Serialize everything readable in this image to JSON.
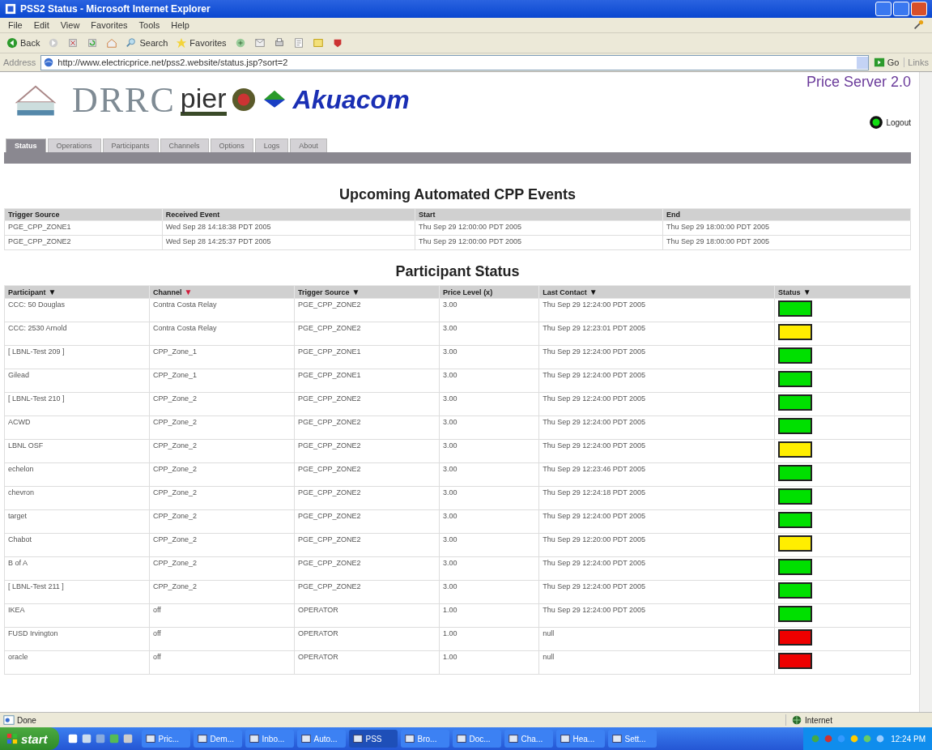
{
  "window": {
    "title": "PSS2 Status - Microsoft Internet Explorer"
  },
  "menu": [
    "File",
    "Edit",
    "View",
    "Favorites",
    "Tools",
    "Help"
  ],
  "toolbar": {
    "back": "Back",
    "search": "Search",
    "favorites": "Favorites"
  },
  "address_bar": {
    "label": "Address",
    "value": "http://www.electricprice.net/pss2.website/status.jsp?sort=2",
    "go": "Go",
    "links": "Links"
  },
  "header": {
    "logos": [
      "DRRC",
      "pier",
      "Akuacom"
    ],
    "product": "Price Server 2.0",
    "logout": "Logout"
  },
  "tabs": [
    {
      "label": "Status",
      "selected": true
    },
    {
      "label": "Operations",
      "selected": false
    },
    {
      "label": "Participants",
      "selected": false
    },
    {
      "label": "Channels",
      "selected": false
    },
    {
      "label": "Options",
      "selected": false
    },
    {
      "label": "Logs",
      "selected": false
    },
    {
      "label": "About",
      "selected": false
    }
  ],
  "events": {
    "title": "Upcoming Automated CPP Events",
    "columns": [
      "Trigger Source",
      "Received Event",
      "Start",
      "End"
    ],
    "rows": [
      [
        "PGE_CPP_ZONE1",
        "Wed Sep 28 14:18:38 PDT 2005",
        "Thu Sep 29 12:00:00 PDT 2005",
        "Thu Sep 29 18:00:00 PDT 2005"
      ],
      [
        "PGE_CPP_ZONE2",
        "Wed Sep 28 14:25:37 PDT 2005",
        "Thu Sep 29 12:00:00 PDT 2005",
        "Thu Sep 29 18:00:00 PDT 2005"
      ]
    ]
  },
  "participants": {
    "title": "Participant Status",
    "columns": [
      {
        "label": "Participant",
        "sort": "▼",
        "sort_active": false
      },
      {
        "label": "Channel",
        "sort": "▼",
        "sort_active": true
      },
      {
        "label": "Trigger Source",
        "sort": "▼",
        "sort_active": false
      },
      {
        "label": "Price Level (x)"
      },
      {
        "label": "Last Contact",
        "sort": "▼",
        "sort_active": false
      },
      {
        "label": "Status",
        "sort": "▼",
        "sort_active": false
      }
    ],
    "rows": [
      {
        "cells": [
          "CCC: 50 Douglas",
          "Contra Costa Relay",
          "PGE_CPP_ZONE2",
          "3.00",
          "Thu Sep 29 12:24:00 PDT 2005"
        ],
        "color": "#00e000"
      },
      {
        "cells": [
          "CCC: 2530 Arnold",
          "Contra Costa Relay",
          "PGE_CPP_ZONE2",
          "3.00",
          "Thu Sep 29 12:23:01 PDT 2005"
        ],
        "color": "#ffee00"
      },
      {
        "cells": [
          "[ LBNL-Test 209 ]",
          "CPP_Zone_1",
          "PGE_CPP_ZONE1",
          "3.00",
          "Thu Sep 29 12:24:00 PDT 2005"
        ],
        "color": "#00e000"
      },
      {
        "cells": [
          "Gilead",
          "CPP_Zone_1",
          "PGE_CPP_ZONE1",
          "3.00",
          "Thu Sep 29 12:24:00 PDT 2005"
        ],
        "color": "#00e000"
      },
      {
        "cells": [
          "[ LBNL-Test 210 ]",
          "CPP_Zone_2",
          "PGE_CPP_ZONE2",
          "3.00",
          "Thu Sep 29 12:24:00 PDT 2005"
        ],
        "color": "#00e000"
      },
      {
        "cells": [
          "ACWD",
          "CPP_Zone_2",
          "PGE_CPP_ZONE2",
          "3.00",
          "Thu Sep 29 12:24:00 PDT 2005"
        ],
        "color": "#00e000"
      },
      {
        "cells": [
          "LBNL OSF",
          "CPP_Zone_2",
          "PGE_CPP_ZONE2",
          "3.00",
          "Thu Sep 29 12:24:00 PDT 2005"
        ],
        "color": "#ffee00"
      },
      {
        "cells": [
          "echelon",
          "CPP_Zone_2",
          "PGE_CPP_ZONE2",
          "3.00",
          "Thu Sep 29 12:23:46 PDT 2005"
        ],
        "color": "#00e000"
      },
      {
        "cells": [
          "chevron",
          "CPP_Zone_2",
          "PGE_CPP_ZONE2",
          "3.00",
          "Thu Sep 29 12:24:18 PDT 2005"
        ],
        "color": "#00e000"
      },
      {
        "cells": [
          "target",
          "CPP_Zone_2",
          "PGE_CPP_ZONE2",
          "3.00",
          "Thu Sep 29 12:24:00 PDT 2005"
        ],
        "color": "#00e000"
      },
      {
        "cells": [
          "Chabot",
          "CPP_Zone_2",
          "PGE_CPP_ZONE2",
          "3.00",
          "Thu Sep 29 12:20:00 PDT 2005"
        ],
        "color": "#ffee00"
      },
      {
        "cells": [
          "B of A",
          "CPP_Zone_2",
          "PGE_CPP_ZONE2",
          "3.00",
          "Thu Sep 29 12:24:00 PDT 2005"
        ],
        "color": "#00e000"
      },
      {
        "cells": [
          "[ LBNL-Test 211 ]",
          "CPP_Zone_2",
          "PGE_CPP_ZONE2",
          "3.00",
          "Thu Sep 29 12:24:00 PDT 2005"
        ],
        "color": "#00e000"
      },
      {
        "cells": [
          "IKEA",
          "off",
          "OPERATOR",
          "1.00",
          "Thu Sep 29 12:24:00 PDT 2005"
        ],
        "color": "#00e000"
      },
      {
        "cells": [
          "FUSD Irvington",
          "off",
          "OPERATOR",
          "1.00",
          "null"
        ],
        "color": "#ee0000"
      },
      {
        "cells": [
          "oracle",
          "off",
          "OPERATOR",
          "1.00",
          "null"
        ],
        "color": "#ee0000"
      }
    ]
  },
  "status_bar": {
    "text": "Done",
    "zone": "Internet"
  },
  "taskbar": {
    "start": "start",
    "items": [
      {
        "label": "Pric...",
        "selected": false
      },
      {
        "label": "Dem...",
        "selected": false
      },
      {
        "label": "Inbo...",
        "selected": false
      },
      {
        "label": "Auto...",
        "selected": false
      },
      {
        "label": "PSS",
        "selected": true
      },
      {
        "label": "Bro...",
        "selected": false
      },
      {
        "label": "Doc...",
        "selected": false
      },
      {
        "label": "Cha...",
        "selected": false
      },
      {
        "label": "Hea...",
        "selected": false
      },
      {
        "label": "Sett...",
        "selected": false
      }
    ],
    "clock": "12:24 PM"
  }
}
